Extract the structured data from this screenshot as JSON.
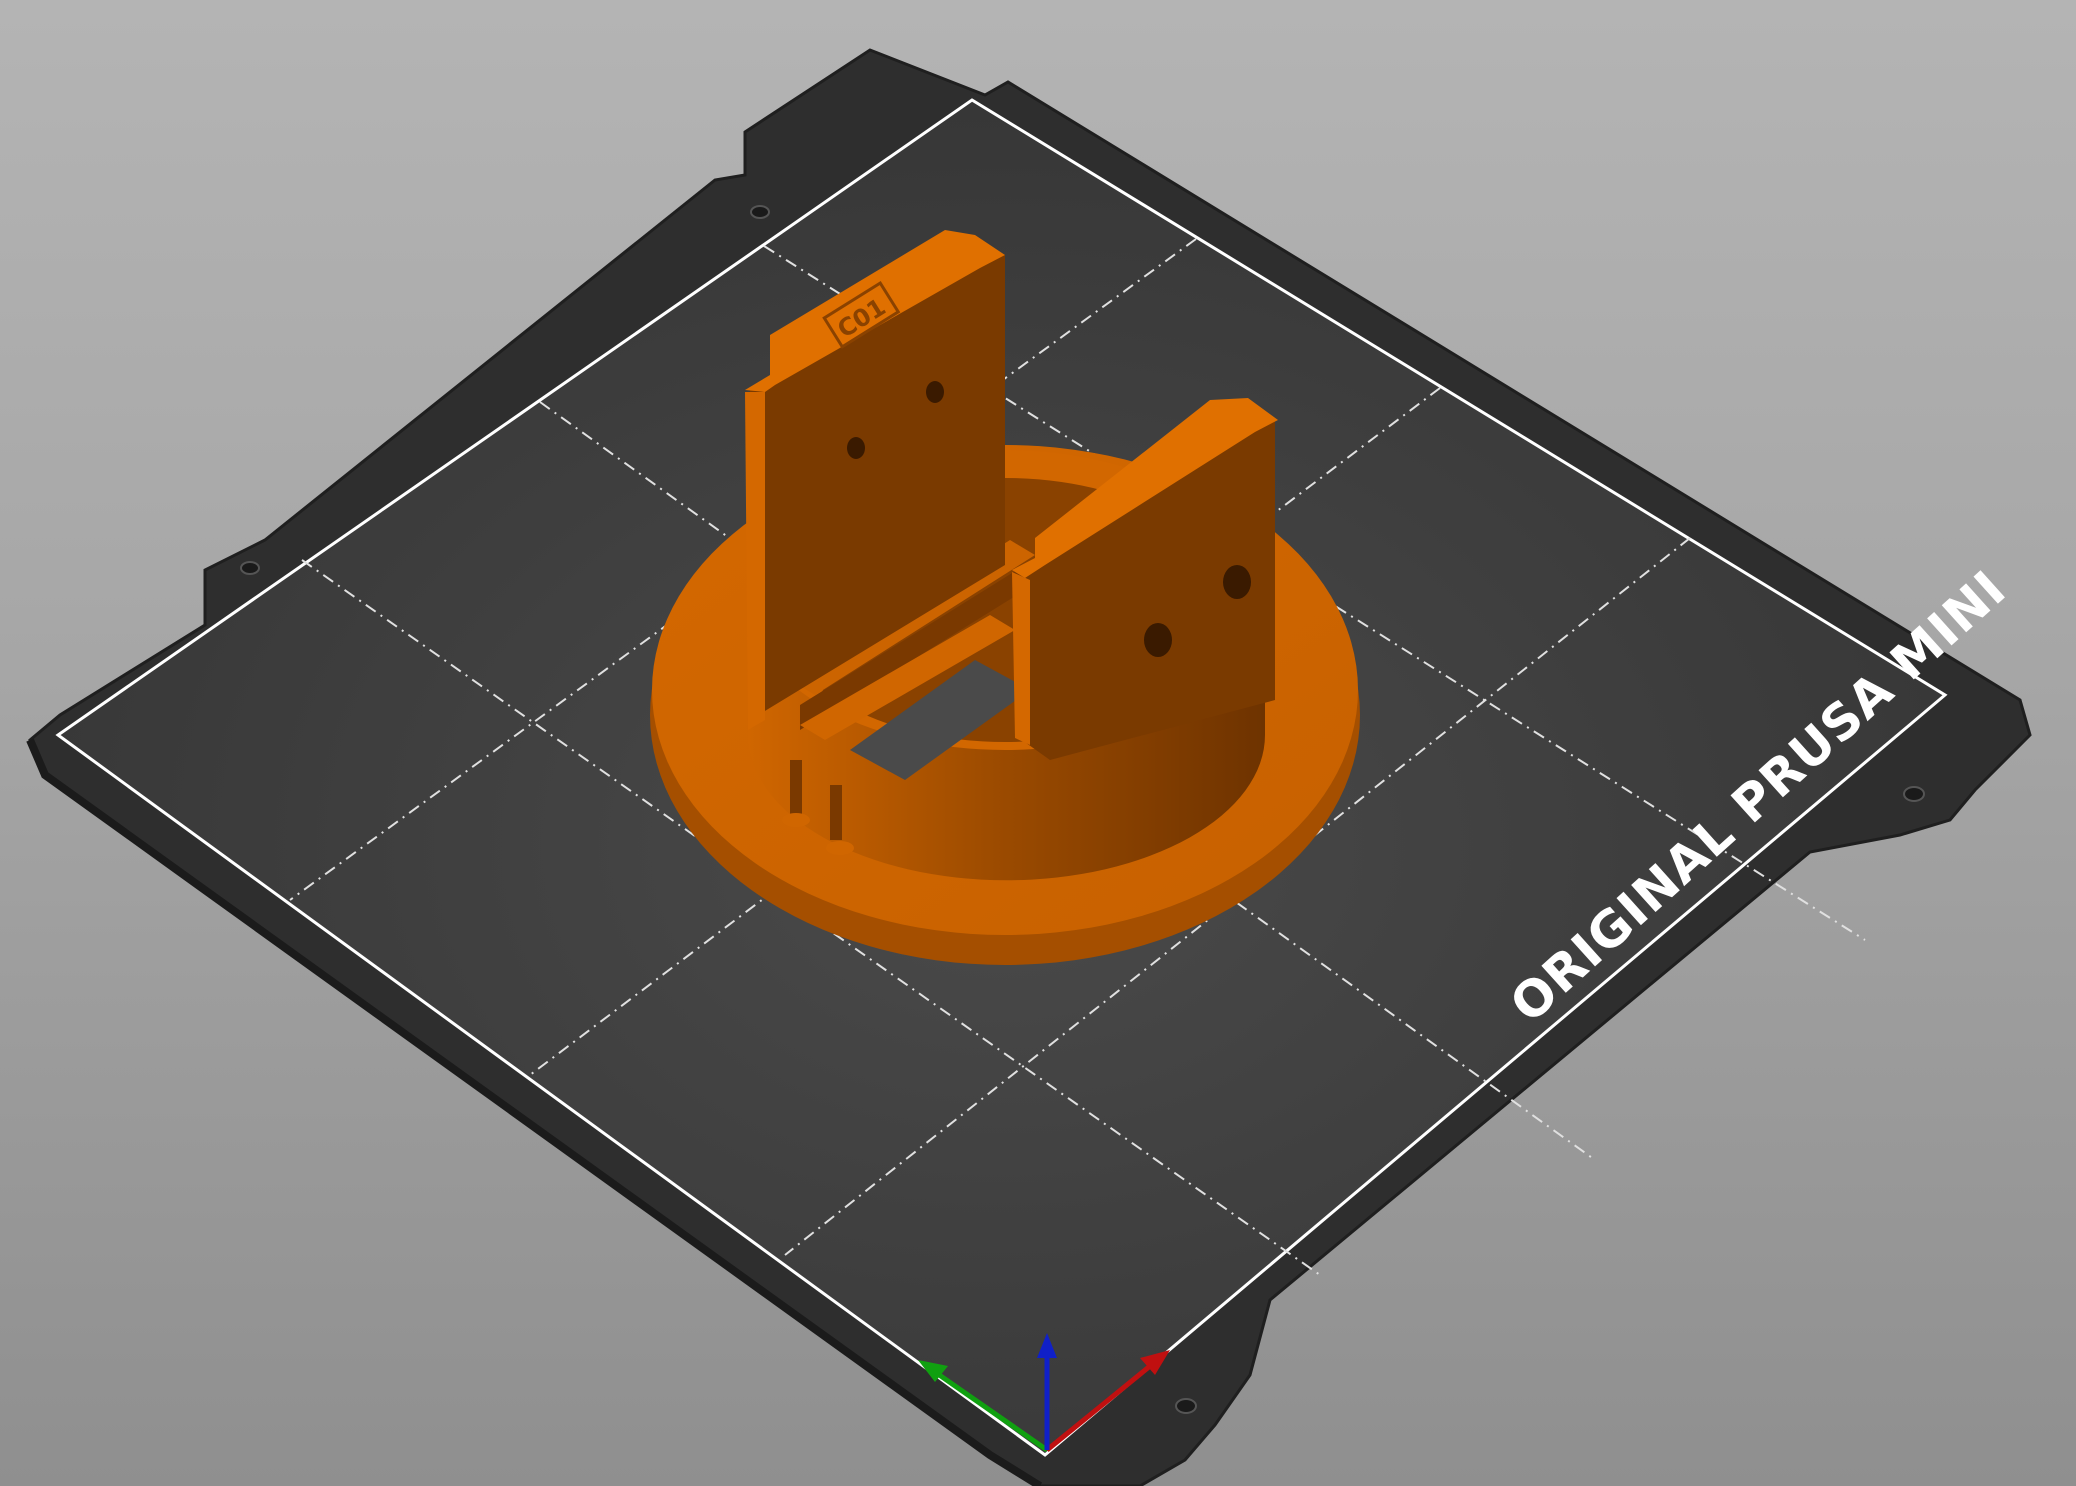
{
  "viewport": {
    "background_top": "#b4b4b4",
    "background_bottom": "#8f8f8f"
  },
  "bed": {
    "label": "ORIGINAL PRUSA MINI",
    "sheet_color": "#2e2e2e",
    "surface_color": "#3d3d3d",
    "border_color": "#ffffff",
    "grid_color": "#e6e6e6"
  },
  "model": {
    "embossed_text": "C01",
    "color_light": "#d86a00",
    "color_mid": "#c45f00",
    "color_dark": "#7a3900"
  },
  "axes": {
    "x_color": "#c01010",
    "y_color": "#10a010",
    "z_color": "#1020c8"
  },
  "icons": {
    "x_axis": "x-axis-arrow-icon",
    "y_axis": "y-axis-arrow-icon",
    "z_axis": "z-axis-arrow-icon"
  }
}
